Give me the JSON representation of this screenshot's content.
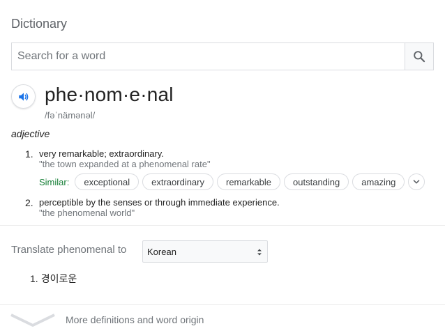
{
  "card": {
    "title": "Dictionary"
  },
  "search": {
    "placeholder": "Search for a word",
    "value": ""
  },
  "entry": {
    "headword": "phe·nom·e·nal",
    "phonetic": "/fəˈnämənəl/",
    "part_of_speech": "adjective",
    "senses": [
      {
        "number": "1.",
        "definition": "very remarkable; extraordinary.",
        "example": "\"the town expanded at a phenomenal rate\""
      },
      {
        "number": "2.",
        "definition": "perceptible by the senses or through immediate experience.",
        "example": "\"the phenomenal world\""
      }
    ],
    "similar": {
      "label": "Similar:",
      "words": [
        "exceptional",
        "extraordinary",
        "remarkable",
        "outstanding",
        "amazing"
      ]
    }
  },
  "translate": {
    "label": "Translate phenomenal to",
    "selected_language": "Korean",
    "results": [
      {
        "number": "1.",
        "text": "경이로운"
      }
    ]
  },
  "footer": {
    "more_label": "More definitions and word origin"
  },
  "colors": {
    "similar_label": "#188038",
    "speaker_icon": "#1a73e8",
    "muted_text": "#70757a",
    "border": "#dadce0"
  },
  "icons": {
    "search": "search-icon",
    "speaker": "speaker-icon",
    "chevron": "chevron-down-icon",
    "select": "select-arrows-icon"
  }
}
